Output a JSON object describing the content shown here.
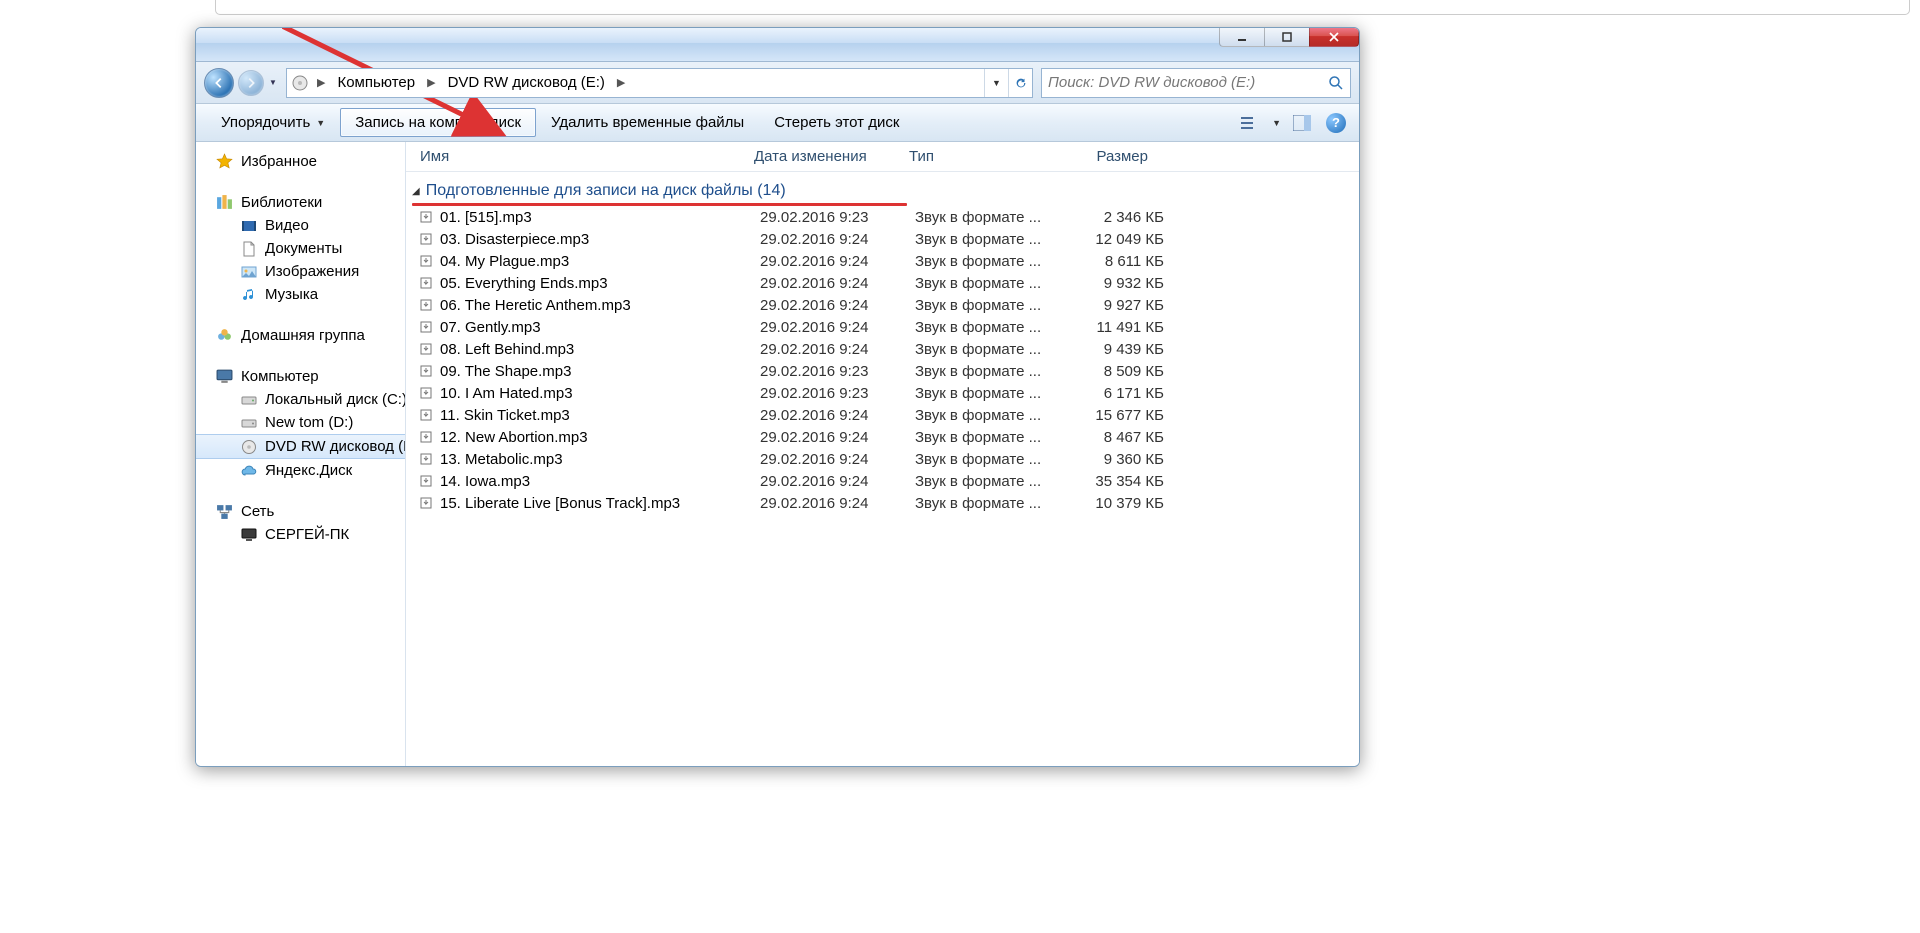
{
  "breadcrumb": {
    "part1": "Компьютер",
    "part2": "DVD RW дисковод (E:)"
  },
  "search": {
    "placeholder": "Поиск: DVD RW дисковод (E:)"
  },
  "toolbar": {
    "organize": "Упорядочить",
    "burn": "Запись на компакт-диск",
    "deleteTemp": "Удалить временные файлы",
    "erase": "Стереть этот диск"
  },
  "columns": {
    "name": "Имя",
    "date": "Дата изменения",
    "type": "Тип",
    "size": "Размер"
  },
  "group_header": "Подготовленные для записи на диск файлы (14)",
  "sidebar": {
    "favorites": "Избранное",
    "libraries": "Библиотеки",
    "lib_video": "Видео",
    "lib_docs": "Документы",
    "lib_images": "Изображения",
    "lib_music": "Музыка",
    "homegroup": "Домашняя группа",
    "computer": "Компьютер",
    "drive_c": "Локальный диск (C:)",
    "drive_d": "New tom (D:)",
    "drive_e": "DVD RW дисковод (E:)",
    "yadisk": "Яндекс.Диск",
    "network": "Сеть",
    "pc1": "СЕРГЕЙ-ПК"
  },
  "file_type_trunc": "Звук в формате ...",
  "files": [
    {
      "name": "01. [515].mp3",
      "date": "29.02.2016 9:23",
      "size": "2 346 КБ"
    },
    {
      "name": "03. Disasterpiece.mp3",
      "date": "29.02.2016 9:24",
      "size": "12 049 КБ"
    },
    {
      "name": "04. My Plague.mp3",
      "date": "29.02.2016 9:24",
      "size": "8 611 КБ"
    },
    {
      "name": "05. Everything Ends.mp3",
      "date": "29.02.2016 9:24",
      "size": "9 932 КБ"
    },
    {
      "name": "06. The Heretic Anthem.mp3",
      "date": "29.02.2016 9:24",
      "size": "9 927 КБ"
    },
    {
      "name": "07. Gently.mp3",
      "date": "29.02.2016 9:24",
      "size": "11 491 КБ"
    },
    {
      "name": "08. Left Behind.mp3",
      "date": "29.02.2016 9:24",
      "size": "9 439 КБ"
    },
    {
      "name": "09. The Shape.mp3",
      "date": "29.02.2016 9:23",
      "size": "8 509 КБ"
    },
    {
      "name": "10. I Am Hated.mp3",
      "date": "29.02.2016 9:23",
      "size": "6 171 КБ"
    },
    {
      "name": "11. Skin Ticket.mp3",
      "date": "29.02.2016 9:24",
      "size": "15 677 КБ"
    },
    {
      "name": "12. New Abortion.mp3",
      "date": "29.02.2016 9:24",
      "size": "8 467 КБ"
    },
    {
      "name": "13. Metabolic.mp3",
      "date": "29.02.2016 9:24",
      "size": "9 360 КБ"
    },
    {
      "name": "14. Iowa.mp3",
      "date": "29.02.2016 9:24",
      "size": "35 354 КБ"
    },
    {
      "name": "15. Liberate Live [Bonus Track].mp3",
      "date": "29.02.2016 9:24",
      "size": "10 379 КБ"
    }
  ]
}
